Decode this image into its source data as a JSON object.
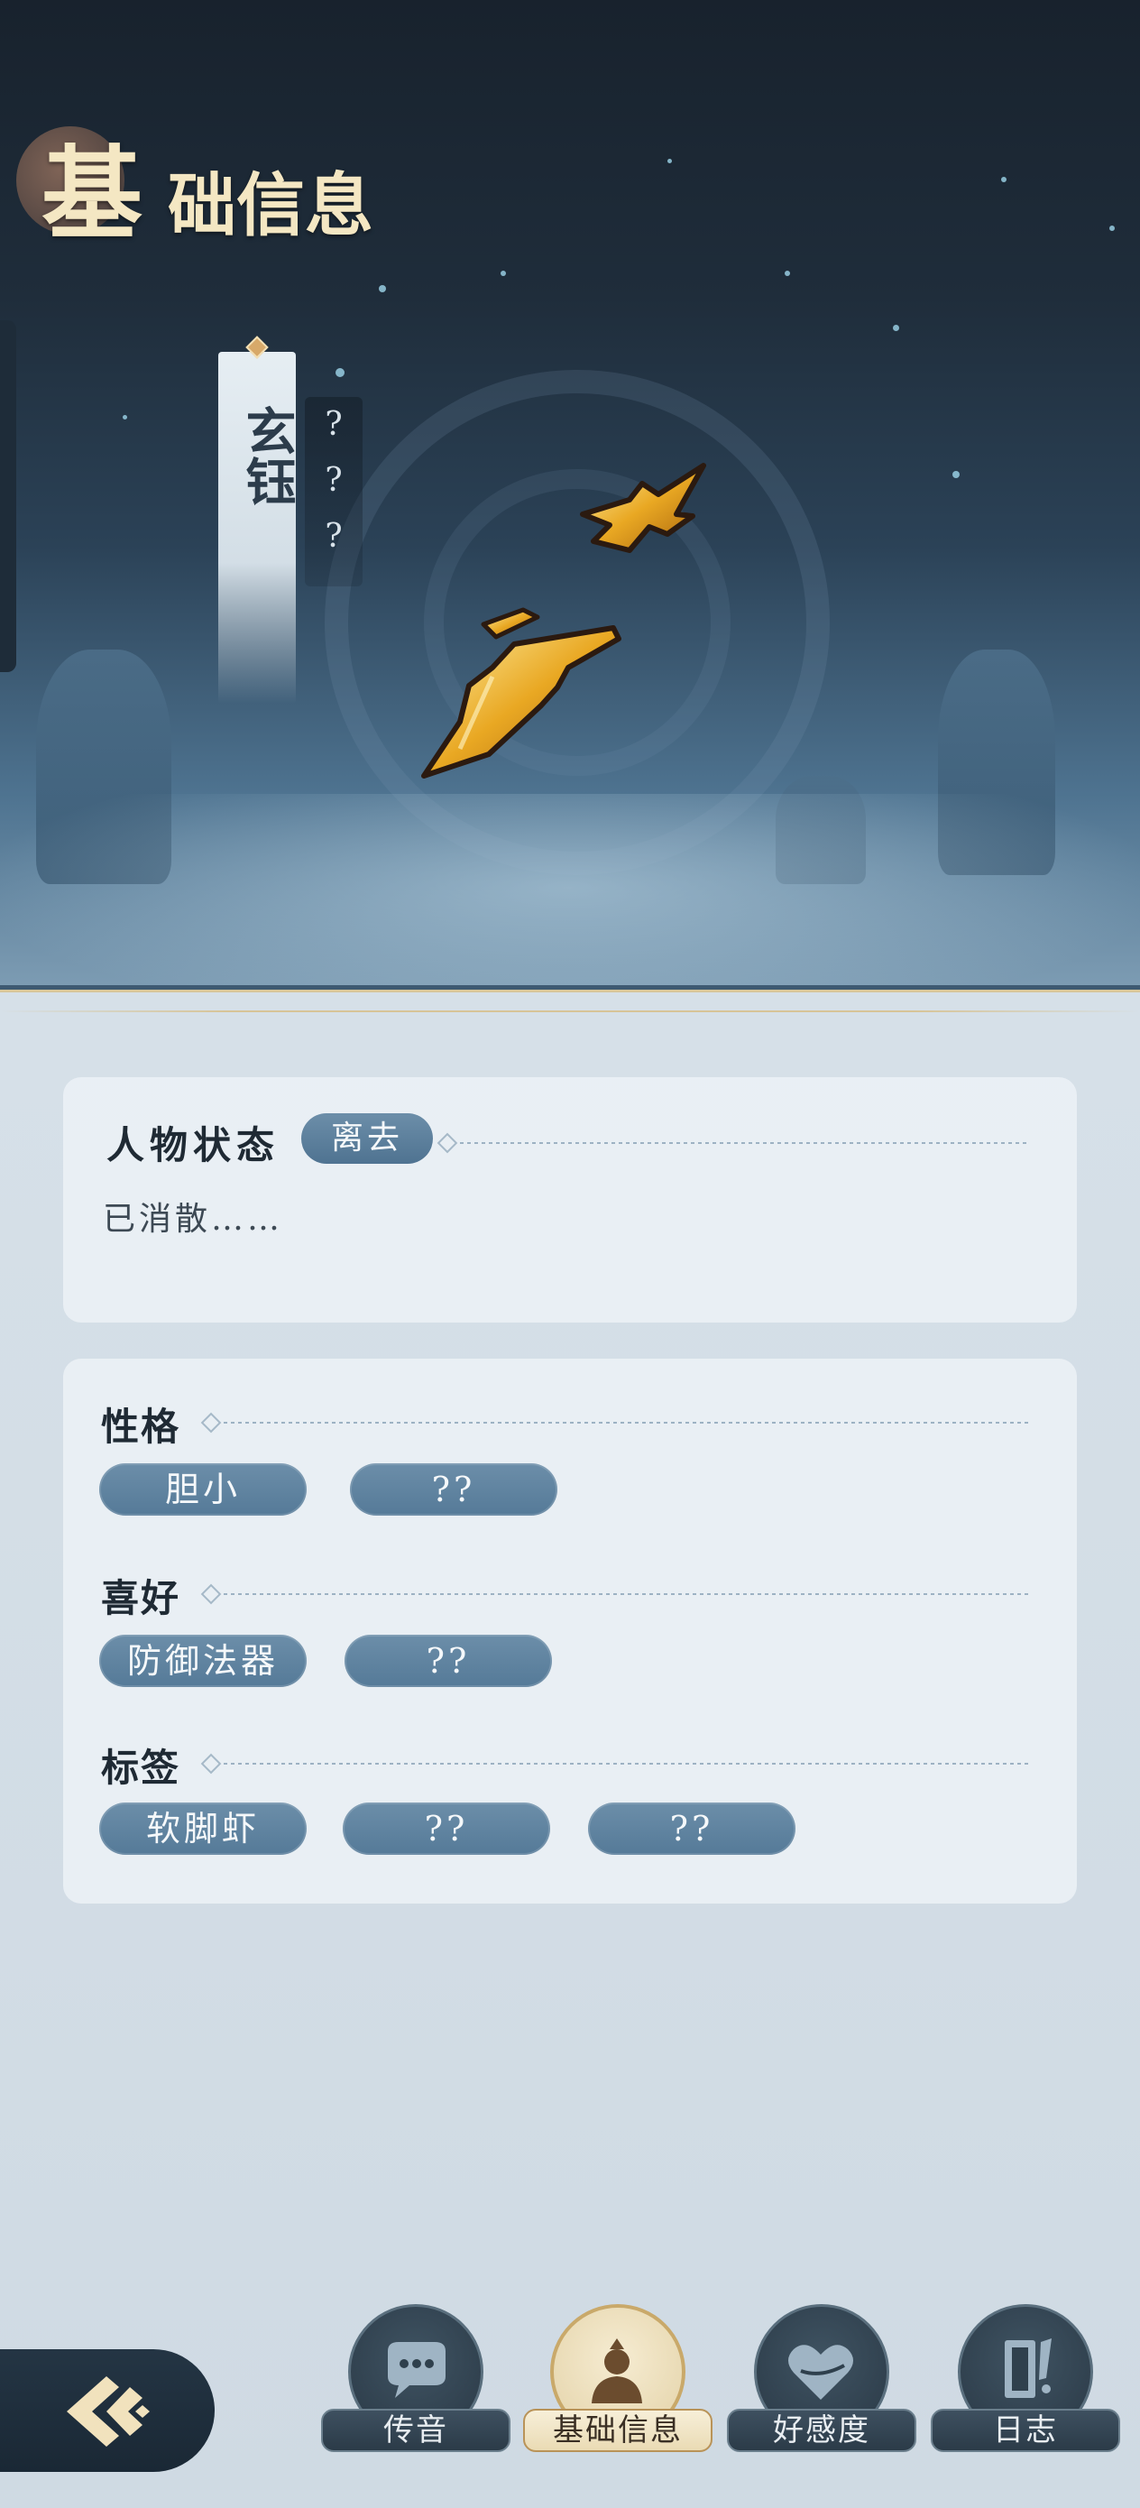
{
  "header": {
    "title_first_char": "基",
    "title_rest": "础信息"
  },
  "character": {
    "name": "玄钰",
    "unknown_marks": [
      "?",
      "?",
      "?"
    ]
  },
  "status_section": {
    "label": "人物状态",
    "status_badge": "离去",
    "description": "已消散……"
  },
  "traits_section": {
    "personality": {
      "label": "性格",
      "tags": [
        "胆小",
        "??"
      ]
    },
    "preferences": {
      "label": "喜好",
      "tags": [
        "防御法器",
        "??"
      ]
    },
    "tags": {
      "label": "标签",
      "tags": [
        "软脚虾",
        "??",
        "??"
      ]
    }
  },
  "bottom_nav": {
    "items": [
      {
        "label": "传音",
        "icon": "chat-bubble-icon",
        "active": false
      },
      {
        "label": "基础信息",
        "icon": "character-portrait-icon",
        "active": true
      },
      {
        "label": "好感度",
        "icon": "heart-icon",
        "active": false
      },
      {
        "label": "日志",
        "icon": "journal-icon",
        "active": false
      }
    ]
  },
  "colors": {
    "accent_gold": "#f4e7c3",
    "pill_blue": "#557a98",
    "panel_bg": "#cfd9e1"
  }
}
